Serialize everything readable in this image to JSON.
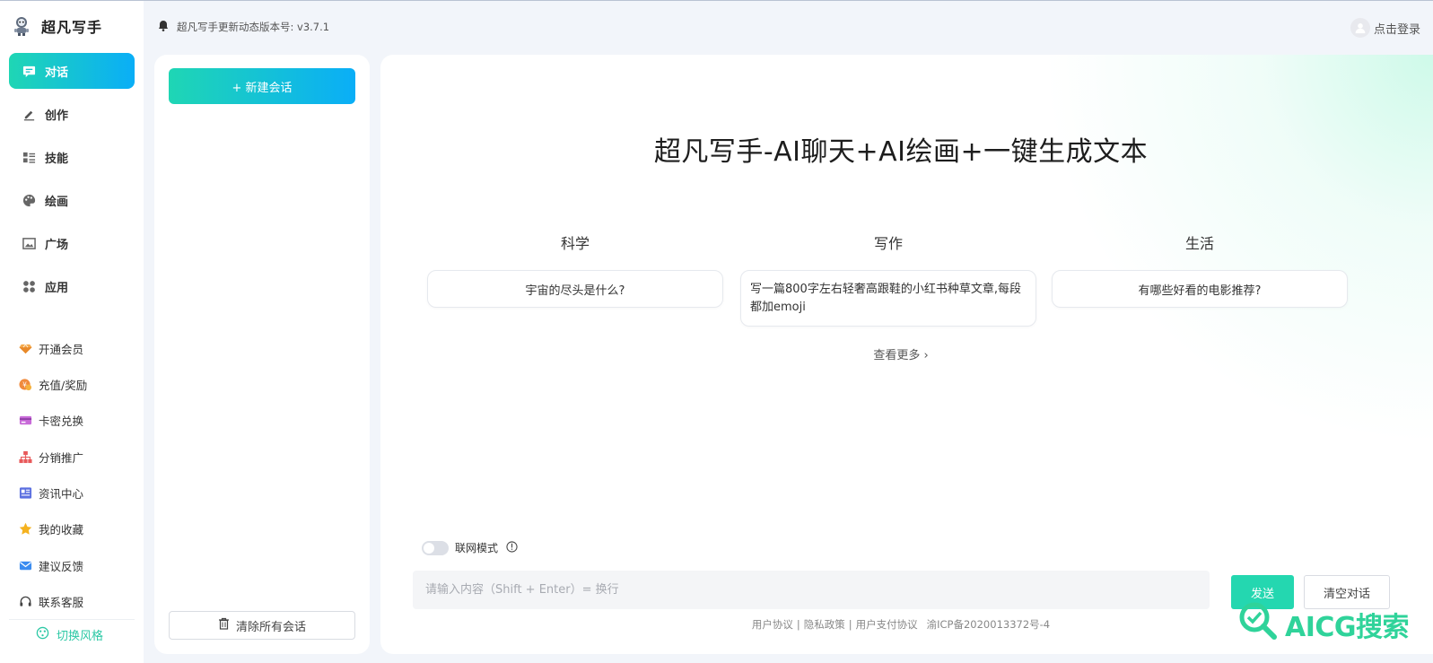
{
  "app": {
    "name": "超凡写手"
  },
  "topbar": {
    "notice": "超凡写手更新动态版本号: v3.7.1",
    "login_label": "点击登录"
  },
  "nav": {
    "main_items": [
      {
        "label": "对话",
        "icon": "chat-icon",
        "active": true
      },
      {
        "label": "创作",
        "icon": "pen-icon",
        "active": false
      },
      {
        "label": "技能",
        "icon": "list-grid-icon",
        "active": false
      },
      {
        "label": "绘画",
        "icon": "palette-icon",
        "active": false
      },
      {
        "label": "广场",
        "icon": "image-icon",
        "active": false
      },
      {
        "label": "应用",
        "icon": "apps-icon",
        "active": false
      }
    ],
    "sub_items": [
      {
        "label": "开通会员",
        "icon": "diamond-icon"
      },
      {
        "label": "充值/奖励",
        "icon": "coin-icon"
      },
      {
        "label": "卡密兑换",
        "icon": "card-icon"
      },
      {
        "label": "分销推广",
        "icon": "network-icon"
      },
      {
        "label": "资讯中心",
        "icon": "news-icon"
      },
      {
        "label": "我的收藏",
        "icon": "star-icon"
      },
      {
        "label": "建议反馈",
        "icon": "mail-icon"
      },
      {
        "label": "联系客服",
        "icon": "headset-icon"
      }
    ],
    "theme_toggle": "切换风格"
  },
  "sessions": {
    "new_chat": "+ 新建会话",
    "clear_all": "清除所有会话"
  },
  "main": {
    "title": "超凡写手-AI聊天+AI绘画+一键生成文本",
    "categories": [
      {
        "heading": "科学",
        "prompt": "宇宙的尽头是什么?"
      },
      {
        "heading": "写作",
        "prompt": "写一篇800字左右轻奢高跟鞋的小红书种草文章,每段都加emoji"
      },
      {
        "heading": "生活",
        "prompt": "有哪些好看的电影推荐?"
      }
    ],
    "more": "查看更多 ›",
    "web_mode": "联网模式",
    "input_placeholder": "请输入内容（Shift + Enter）= 换行",
    "send": "发送",
    "clear_chat": "清空对话"
  },
  "footer": {
    "links": [
      "用户协议",
      "隐私政策",
      "用户支付协议"
    ],
    "icp": "渝ICP备2020013372号-4"
  },
  "watermark": {
    "text": "AICG搜索"
  },
  "colors": {
    "accent_start": "#1fd6b4",
    "accent_end": "#0aaef7",
    "send": "#24d7b0",
    "watermark": "#2fd39a"
  }
}
